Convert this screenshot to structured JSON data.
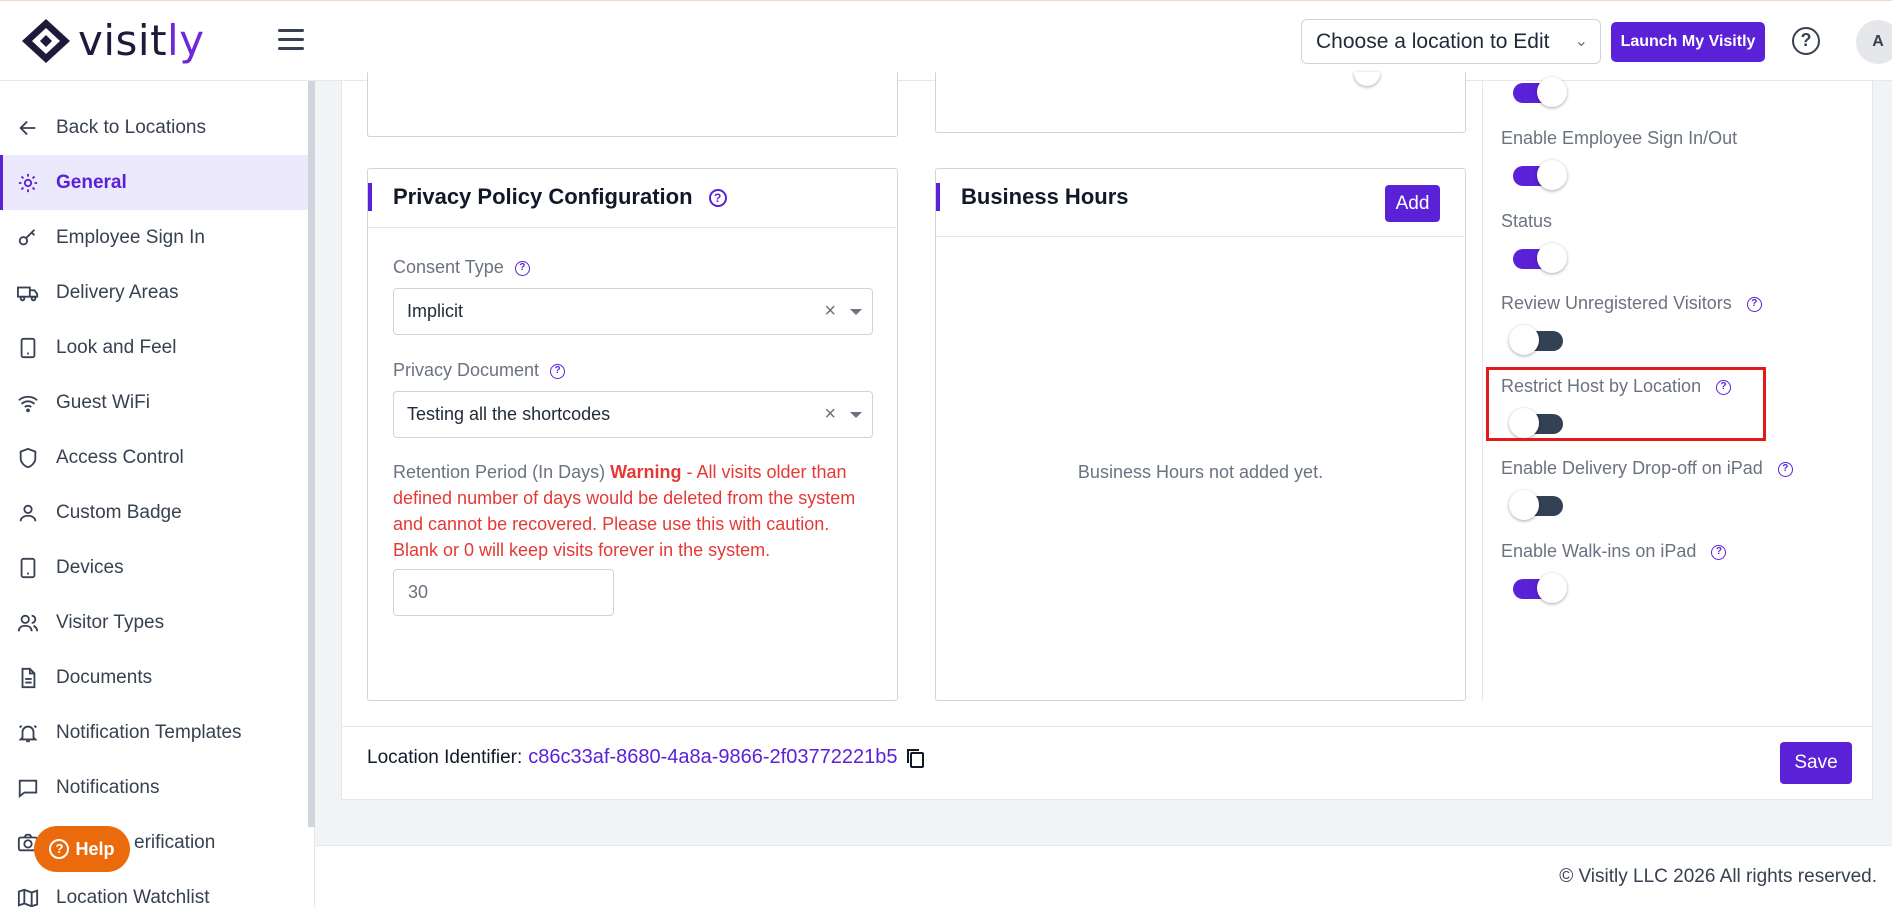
{
  "header": {
    "logo_text_main": "visit",
    "logo_text_accent": "ly",
    "location_select": "Choose a location to Edit",
    "launch_button": "Launch My Visitly",
    "help_glyph": "?",
    "avatar_initial": "A"
  },
  "sidebar": {
    "items": [
      {
        "label": "Back to Locations",
        "icon": "arrow-left-icon"
      },
      {
        "label": "General",
        "icon": "gear-icon",
        "active": true
      },
      {
        "label": "Employee Sign In",
        "icon": "key-icon"
      },
      {
        "label": "Delivery Areas",
        "icon": "truck-icon"
      },
      {
        "label": "Look and Feel",
        "icon": "tablet-icon"
      },
      {
        "label": "Guest WiFi",
        "icon": "wifi-icon"
      },
      {
        "label": "Access Control",
        "icon": "shield-icon"
      },
      {
        "label": "Custom Badge",
        "icon": "user-icon"
      },
      {
        "label": "Devices",
        "icon": "device-icon"
      },
      {
        "label": "Visitor Types",
        "icon": "users-icon"
      },
      {
        "label": "Documents",
        "icon": "document-icon"
      },
      {
        "label": "Notification Templates",
        "icon": "bell-icon"
      },
      {
        "label": "Notifications",
        "icon": "chat-icon"
      },
      {
        "label": "ID Verification",
        "icon": "camera-icon"
      },
      {
        "label": "Location Watchlist",
        "icon": "map-icon"
      }
    ],
    "help_button": "Help",
    "visible_partial_label": "erification"
  },
  "privacy": {
    "title": "Privacy Policy Configuration",
    "consent_label": "Consent Type",
    "consent_value": "Implicit",
    "document_label": "Privacy Document",
    "document_value": "Testing all the shortcodes",
    "retention_label": "Retention Period (In Days)",
    "warning_word": "Warning",
    "warning_text": " - All visits older than defined number of days would be deleted from the system and cannot be recovered. Please use this with caution. Blank or 0 will keep visits forever in the system.",
    "retention_value": "30",
    "clear_glyph": "×"
  },
  "business_hours": {
    "title": "Business Hours",
    "add_button": "Add",
    "empty_message": "Business Hours not added yet."
  },
  "toggles": [
    {
      "label": "",
      "on": true
    },
    {
      "label": "Enable Employee Sign In/Out",
      "on": true
    },
    {
      "label": "Status",
      "on": true
    },
    {
      "label": "Review Unregistered Visitors",
      "on": false,
      "help": true
    },
    {
      "label": "Restrict Host by Location",
      "on": false,
      "help": true
    },
    {
      "label": "Enable Delivery Drop-off on iPad",
      "on": false,
      "help": true
    },
    {
      "label": "Enable Walk-ins on iPad",
      "on": true,
      "help": true
    }
  ],
  "footer": {
    "location_identifier_label": "Location Identifier:",
    "location_identifier_value": "c86c33af-8680-4a8a-9866-2f03772221b5",
    "save_button": "Save",
    "copyright": "© Visitly LLC 2026 All rights reserved."
  },
  "colors": {
    "accent": "#5b21d6",
    "warning": "#e53935",
    "help_orange": "#ea6a0c",
    "highlight_red": "#e01b1b"
  }
}
